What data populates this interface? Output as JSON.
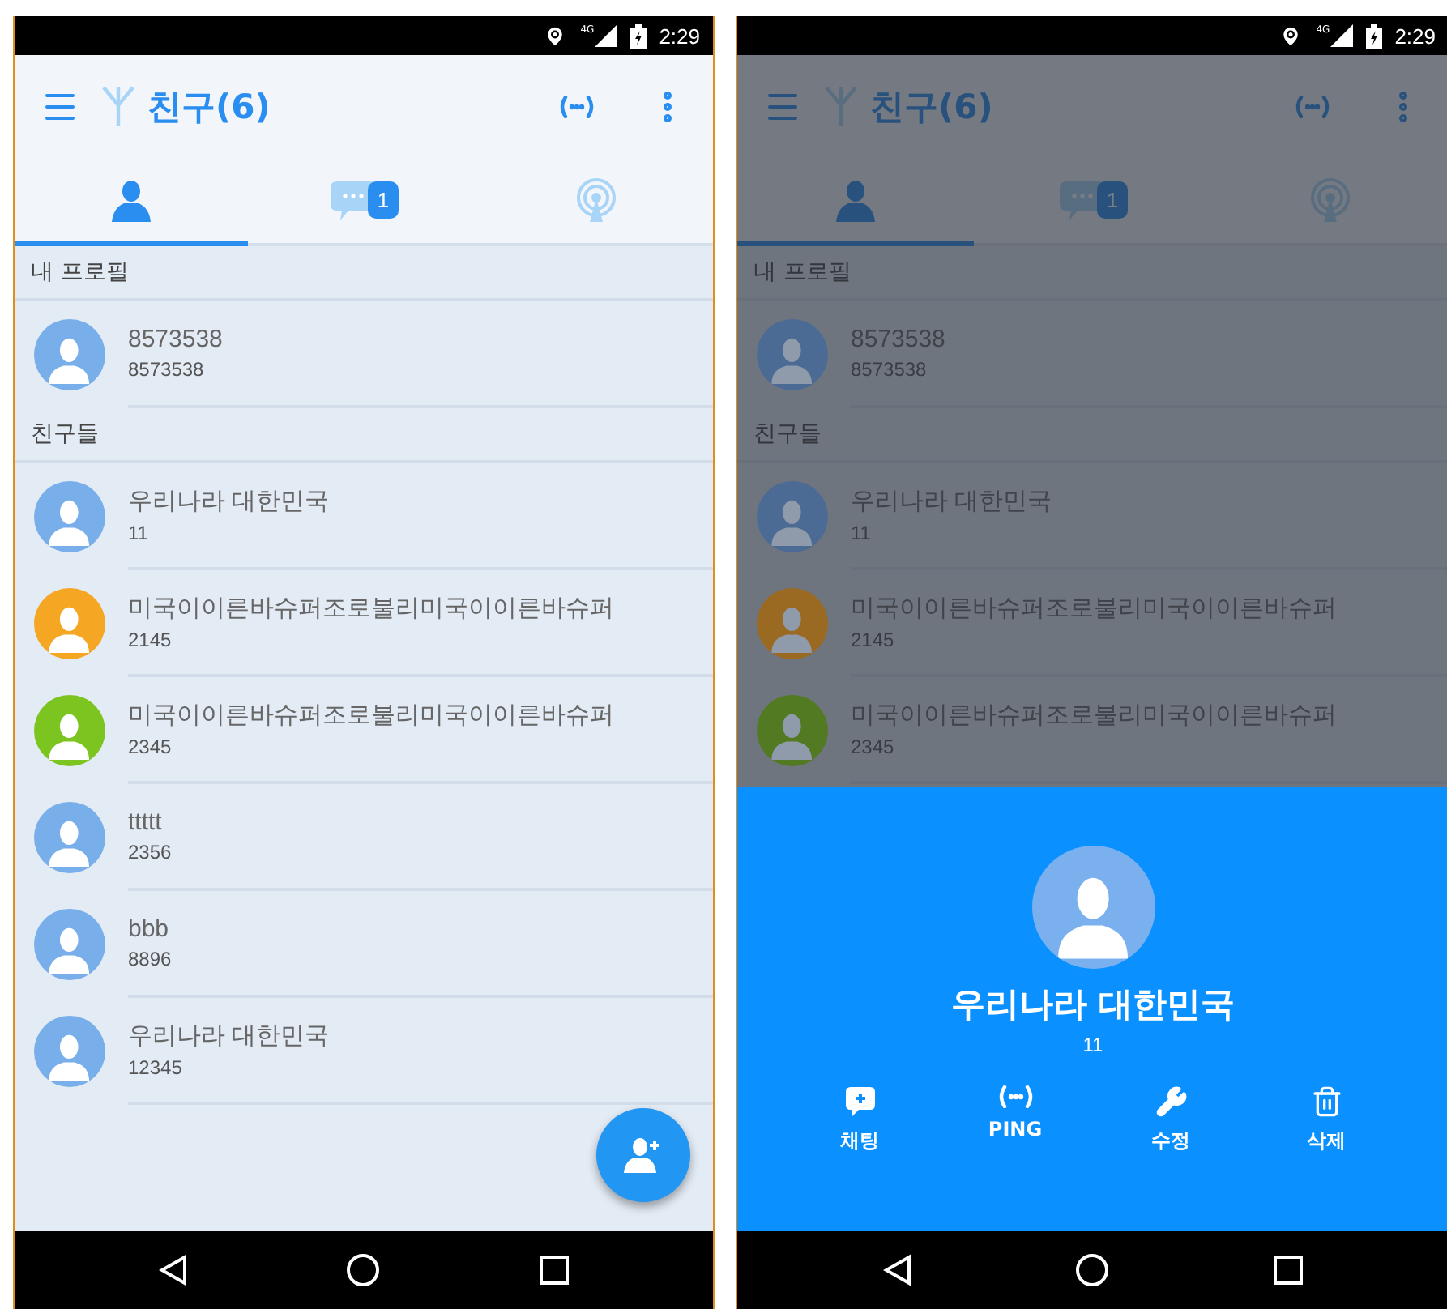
{
  "screens": [
    {
      "dimmed": false,
      "status_bar": {
        "network": "4G",
        "time": "2:29"
      },
      "toolbar": {
        "title": "친구(6)"
      },
      "tabs": [
        {
          "kind": "friends",
          "selected": true
        },
        {
          "kind": "chats",
          "badge": "1",
          "selected": false
        },
        {
          "kind": "broadcast",
          "selected": false
        }
      ],
      "sections": [
        {
          "title": "내 프로필",
          "items": [
            {
              "name": "8573538",
              "detail": "8573538",
              "color": "#78aeea"
            }
          ]
        },
        {
          "title": "친구들",
          "items": [
            {
              "name": "우리나라 대한민국",
              "detail": "11",
              "color": "#78aeea"
            },
            {
              "name": "미국이이른바슈퍼조로불리미국이이른바슈퍼",
              "detail": "2145",
              "color": "#f5a623"
            },
            {
              "name": "미국이이른바슈퍼조로불리미국이이른바슈퍼",
              "detail": "2345",
              "color": "#7cc520"
            },
            {
              "name": "ttttt",
              "detail": "2356",
              "color": "#78aeea"
            },
            {
              "name": "bbb",
              "detail": "8896",
              "color": "#78aeea"
            },
            {
              "name": "우리나라 대한민국",
              "detail": "12345",
              "color": "#78aeea"
            }
          ]
        }
      ],
      "fab": true
    },
    {
      "dimmed": true,
      "status_bar": {
        "network": "4G",
        "time": "2:29"
      },
      "toolbar": {
        "title": "친구(6)"
      },
      "tabs": [
        {
          "kind": "friends",
          "selected": true
        },
        {
          "kind": "chats",
          "badge": "1",
          "selected": false
        },
        {
          "kind": "broadcast",
          "selected": false
        }
      ],
      "sections": [
        {
          "title": "내 프로필",
          "items": [
            {
              "name": "8573538",
              "detail": "8573538",
              "color": "#4c6b94"
            }
          ]
        },
        {
          "title": "친구들",
          "items": [
            {
              "name": "우리나라 대한민국",
              "detail": "11",
              "color": "#4c6b94"
            },
            {
              "name": "미국이이른바슈퍼조로불리미국이이른바슈퍼",
              "detail": "2145",
              "color": "#9a6a22"
            },
            {
              "name": "미국이이른바슈퍼조로불리미국이이른바슈퍼",
              "detail": "2345",
              "color": "#527a22"
            }
          ]
        }
      ],
      "fab": false,
      "bottom_sheet": {
        "name": "우리나라 대한민국",
        "detail": "11",
        "actions": [
          {
            "kind": "chat",
            "label": "채팅"
          },
          {
            "kind": "ping",
            "label": "PING"
          },
          {
            "kind": "edit",
            "label": "수정"
          },
          {
            "kind": "delete",
            "label": "삭제"
          }
        ]
      }
    }
  ]
}
